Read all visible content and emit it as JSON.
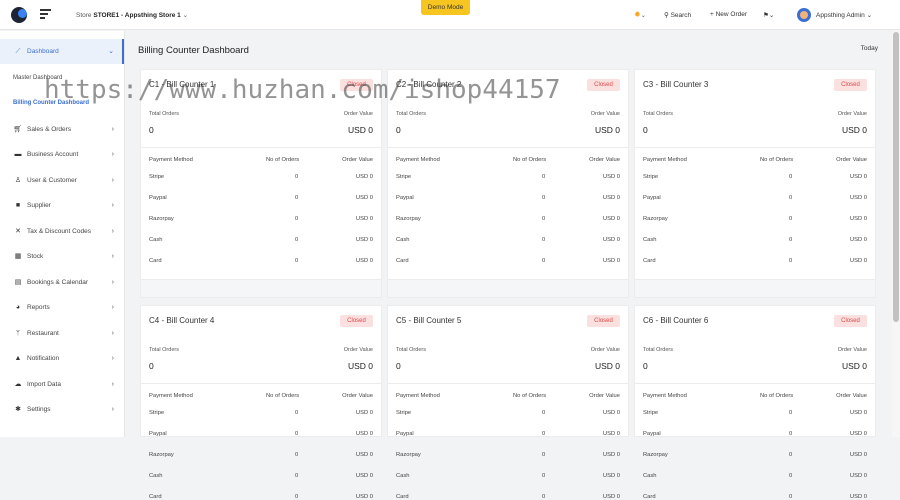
{
  "header": {
    "store_prefix": "Store",
    "store_name": "STORE1 - Appsthing Store 1",
    "demo_label": "Demo Mode",
    "search_label": "Search",
    "new_order_label": "+ New Order",
    "user_name": "Appsthing Admin"
  },
  "sidebar": {
    "items": [
      {
        "label": "Dashboard",
        "icon": "chart-line-icon"
      },
      {
        "label": "Sales & Orders",
        "icon": "cart-icon"
      },
      {
        "label": "Business Account",
        "icon": "id-card-icon"
      },
      {
        "label": "User & Customer",
        "icon": "user-icon"
      },
      {
        "label": "Supplier",
        "icon": "truck-icon"
      },
      {
        "label": "Tax & Discount Codes",
        "icon": "percent-icon"
      },
      {
        "label": "Stock",
        "icon": "boxes-icon"
      },
      {
        "label": "Bookings & Calendar",
        "icon": "calendar-icon"
      },
      {
        "label": "Reports",
        "icon": "pie-chart-icon"
      },
      {
        "label": "Restaurant",
        "icon": "utensils-icon"
      },
      {
        "label": "Notification",
        "icon": "bell-icon"
      },
      {
        "label": "Import Data",
        "icon": "cloud-upload-icon"
      },
      {
        "label": "Settings",
        "icon": "gear-icon"
      }
    ],
    "sub": [
      "Master Dashboard",
      "Billing Counter Dashboard"
    ]
  },
  "main": {
    "title": "Billing Counter Dashboard",
    "range": "Today"
  },
  "labels": {
    "total_orders": "Total Orders",
    "order_value": "Order Value",
    "payment_method": "Payment Method",
    "no_of_orders": "No of Orders",
    "order_value_col": "Order Value",
    "status": "Closed",
    "zero": "0",
    "usd_zero": "USD 0"
  },
  "counters": [
    {
      "title": "C1 - Bill Counter 1"
    },
    {
      "title": "C2 - Bill Counter 2"
    },
    {
      "title": "C3 - Bill Counter 3"
    },
    {
      "title": "C4 - Bill Counter 4"
    },
    {
      "title": "C5 - Bill Counter 5"
    },
    {
      "title": "C6 - Bill Counter 6"
    }
  ],
  "payment_methods": [
    "Stripe",
    "Paypal",
    "Razorpay",
    "Cash",
    "Card"
  ],
  "watermark": "https://www.huzhan.com/ishop44157",
  "colors": {
    "accent": "#3c6fcf",
    "closed_bg": "#fbe0e0",
    "closed_text": "#e04848",
    "demo": "#f7c51f"
  }
}
